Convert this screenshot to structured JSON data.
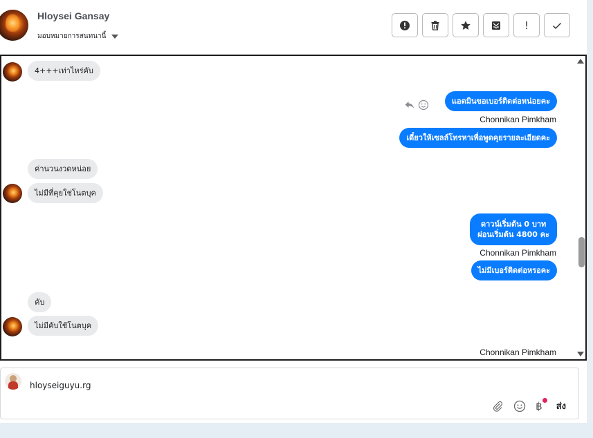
{
  "header": {
    "contact_name": "Hloysei Gansay",
    "assign_label": "มอบหมายการสนทนานี้",
    "toolbar": [
      {
        "name": "alert-circle-icon"
      },
      {
        "name": "trash-icon"
      },
      {
        "name": "star-icon"
      },
      {
        "name": "archive-icon"
      },
      {
        "name": "exclamation-icon",
        "glyph": "!"
      },
      {
        "name": "check-icon"
      }
    ]
  },
  "messages": {
    "m1": "4+++เท่าไหร่คับ",
    "m2": "แอดมินขอเบอร์ติดต่อหน่อยคะ",
    "sender1": "Chonnikan Pimkham",
    "m3": "เดี๋ยวให้เซลล์โทรหาเพื่อพูดคุยรายละเอียดคะ",
    "m4": "ค่านวนงวดหน่อย",
    "m5": "ไม่มีที่คุยใช่โนตบุค",
    "m6_line1": "ดาวน์เริ่มต้น 0 บาท",
    "m6_line2": "ผ่อนเริ่มต้น 4800 คะ",
    "sender2": "Chonnikan Pimkham",
    "m7": "ไม่มีเบอร์ติดต่อหรอคะ",
    "m8": "คับ",
    "m9": "ไม่มีคับใช้โนตบุค",
    "sender3": "Chonnikan Pimkham"
  },
  "composer": {
    "value": "hloyseiguyu.rg",
    "send_label": "ส่ง",
    "currency_glyph": "฿"
  },
  "colors": {
    "outgoing_bubble": "#0a7cff",
    "incoming_bubble": "#e9eaec",
    "notification_dot": "#e0245e"
  }
}
